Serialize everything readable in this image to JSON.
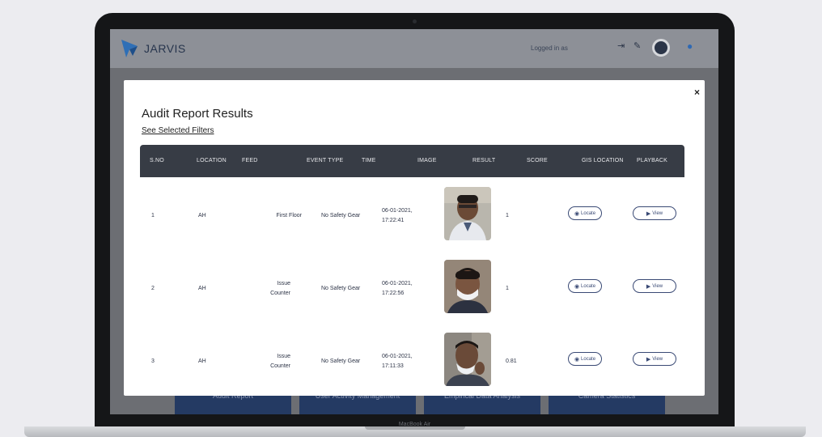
{
  "app": {
    "title": "JARVIS",
    "logged_in_label": "Logged in as"
  },
  "background_tiles": [
    "Audit Report",
    "User Activity Management",
    "Empirical Data Analysis",
    "Camera Statistics"
  ],
  "modal": {
    "close_label": "×",
    "title": "Audit Report Results",
    "filters_link": "See Selected Filters",
    "columns": [
      "S.NO",
      "LOCATION",
      "FEED",
      "EVENT TYPE",
      "TIME",
      "IMAGE",
      "RESULT",
      "SCORE",
      "GIS LOCATION",
      "PLAYBACK"
    ],
    "rows": [
      {
        "sno": "1",
        "location": "AH",
        "feed": "First Floor",
        "event_type": "No Safety Gear",
        "time_date": "06-01-2021,",
        "time_clock": "17:22:41",
        "score": "1",
        "locate_label": "Locate",
        "view_label": "View"
      },
      {
        "sno": "2",
        "location": "AH",
        "feed_line1": "Issue",
        "feed_line2": "Counter",
        "event_type": "No Safety Gear",
        "time_date": "06-01-2021,",
        "time_clock": "17:22:56",
        "score": "1",
        "locate_label": "Locate",
        "view_label": "View"
      },
      {
        "sno": "3",
        "location": "AH",
        "feed_line1": "Issue",
        "feed_line2": "Counter",
        "event_type": "No Safety Gear",
        "time_date": "06-01-2021,",
        "time_clock": "17:11:33",
        "score": "0.81",
        "locate_label": "Locate",
        "view_label": "View"
      }
    ]
  },
  "device_label": "MacBook Air",
  "icons": {
    "logout": "logout-icon",
    "settings": "wrench-icon",
    "avatar": "avatar-icon",
    "mic": "mic-icon",
    "close": "close-icon",
    "locate": "location-pin-icon",
    "view": "play-icon"
  },
  "colors": {
    "header_dark": "#373c45",
    "pill_border": "#3a4a75",
    "tile_blue": "#243a63"
  }
}
